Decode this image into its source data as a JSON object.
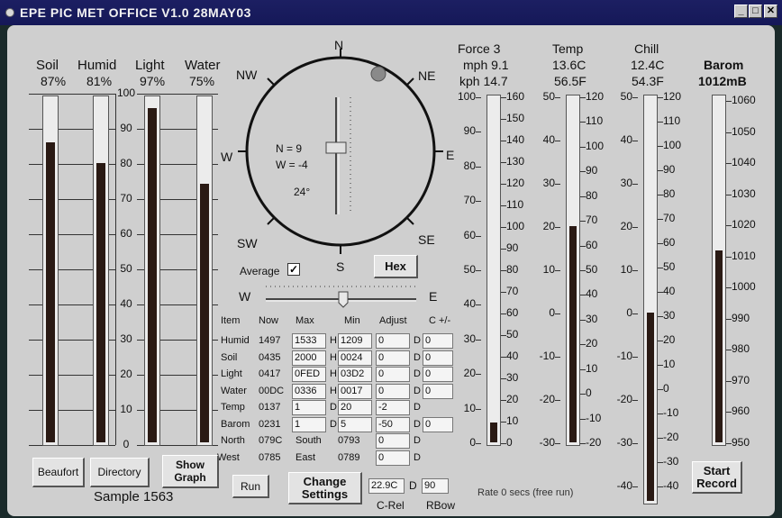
{
  "window": {
    "title": "EPE PIC MET OFFICE V1.0 28MAY03",
    "buttons": [
      "_",
      "□",
      "✕"
    ]
  },
  "left_gauges": [
    {
      "name": "Soil",
      "value": "87%",
      "level": 0.87
    },
    {
      "name": "Humid",
      "value": "81%",
      "level": 0.81
    },
    {
      "name": "Light",
      "value": "97%",
      "level": 0.97
    },
    {
      "name": "Water",
      "value": "75%",
      "level": 0.75
    }
  ],
  "left_ticks": [
    "100",
    "90",
    "80",
    "70",
    "60",
    "50",
    "40",
    "30",
    "20",
    "10",
    "0"
  ],
  "compass": {
    "N": "N",
    "NE": "NE",
    "E": "E",
    "SE": "SE",
    "S": "S",
    "SW": "SW",
    "W": "W",
    "NW": "NW",
    "n_value": "N = 9",
    "w_value": "W = -4",
    "angle": "24°",
    "average_label": "Average",
    "average_checked": true,
    "hex_label": "Hex",
    "slider_w": "W",
    "slider_e": "E"
  },
  "table": {
    "headers": [
      "Item",
      "Now",
      "Max",
      "Min",
      "Adjust",
      "C +/-"
    ],
    "rows": [
      {
        "item": "Humid",
        "now": "1497",
        "max": "1533",
        "hmax": "H",
        "min": "1209",
        "d": "D",
        "adj": "0",
        "c": "0"
      },
      {
        "item": "Soil",
        "now": "0435",
        "max": "2000",
        "hmax": "H",
        "min": "0024",
        "d": "D",
        "adj": "0",
        "c": "0"
      },
      {
        "item": "Light",
        "now": "0417",
        "max": "0FED",
        "hmax": "H",
        "min": "03D2",
        "d": "D",
        "adj": "0",
        "c": "0"
      },
      {
        "item": "Water",
        "now": "00DC",
        "max": "0336",
        "hmax": "H",
        "min": "0017",
        "d": "D",
        "adj": "0",
        "c": "0"
      },
      {
        "item": "Temp",
        "now": "0137",
        "max": "1",
        "hmax": "D",
        "min": "20",
        "d": "D",
        "adj": "-2",
        "c": ""
      },
      {
        "item": "Barom",
        "now": "0231",
        "max": "1",
        "hmax": "D",
        "min": "5",
        "d": "D",
        "adj": "-50",
        "c": "0"
      }
    ],
    "north_label": "North",
    "north_value": "079C",
    "south_label": "South",
    "south_value": "0793",
    "west_label": "West",
    "west_value": "0785",
    "east_label": "East",
    "east_value": "0789",
    "north_adj": "0",
    "west_adj": "0",
    "nd": "D",
    "wd": "D"
  },
  "bottom": {
    "beaufort": "Beaufort",
    "directory": "Directory",
    "show_graph": "Show Graph",
    "sample": "Sample 1563",
    "run": "Run",
    "change_settings": "Change Settings",
    "crel_value": "22.9C",
    "crel_d": "D",
    "rbow_value": "90",
    "crel_label": "C-Rel",
    "rbow_label": "RBow",
    "rate": "Rate 0  secs (free run)",
    "start_record": "Start Record"
  },
  "force": {
    "title": "Force  3",
    "mph": "mph 9.1",
    "kph": "kph  14.7",
    "level": 0.057,
    "left_ticks": [
      "100",
      "90",
      "80",
      "70",
      "60",
      "50",
      "40",
      "30",
      "20",
      "10",
      "0"
    ],
    "right_ticks": [
      "160",
      "150",
      "140",
      "130",
      "120",
      "110",
      "100",
      "90",
      "80",
      "70",
      "60",
      "50",
      "40",
      "30",
      "20",
      "10",
      "0"
    ]
  },
  "temp": {
    "title": "Temp",
    "c": "13.6C",
    "f": "56.5F",
    "level": 0.625,
    "left_ticks": [
      "50",
      "40",
      "30",
      "20",
      "10",
      "0",
      "-10",
      "-20",
      "-30"
    ],
    "right_ticks": [
      "120",
      "110",
      "100",
      "90",
      "80",
      "70",
      "60",
      "50",
      "40",
      "30",
      "20",
      "10",
      "0",
      "-10",
      "-20"
    ]
  },
  "chill": {
    "title": "Chill",
    "c": "12.4C",
    "f": "54.3F",
    "level": 0.465,
    "left_ticks": [
      "50",
      "40",
      "30",
      "20",
      "10",
      "0",
      "-10",
      "-20",
      "-30",
      "-40"
    ],
    "right_ticks": [
      "120",
      "110",
      "100",
      "90",
      "80",
      "70",
      "60",
      "50",
      "40",
      "30",
      "20",
      "10",
      "0",
      "-10",
      "-20",
      "-30",
      "-40"
    ]
  },
  "barom": {
    "title": "Barom",
    "value": "1012mB",
    "level": 0.555,
    "ticks": [
      "1060",
      "1050",
      "1040",
      "1030",
      "1020",
      "1010",
      "1000",
      "990",
      "980",
      "970",
      "960",
      "950"
    ]
  },
  "colors": {
    "panel": "#cfcfcf",
    "titlebar": "#1c1f62",
    "fill": "#2a1a14",
    "marker": "#8a8a8a"
  }
}
